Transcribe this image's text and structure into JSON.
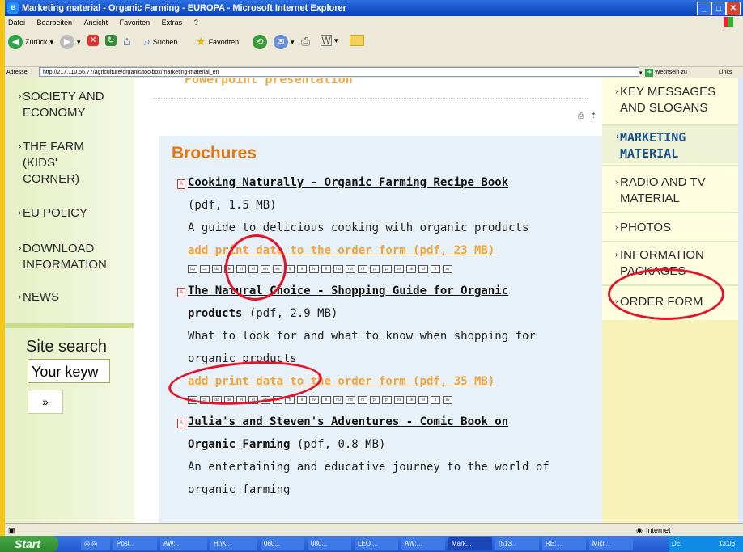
{
  "window": {
    "title": "Marketing material - Organic Farming - EUROPA - Microsoft Internet Explorer"
  },
  "menubar": [
    "Datei",
    "Bearbeiten",
    "Ansicht",
    "Favoriten",
    "Extras",
    "?"
  ],
  "toolbar": {
    "back": "Zurück",
    "search": "Suchen",
    "favorites": "Favoriten"
  },
  "addressbar": {
    "label": "Adresse",
    "url": "http://217.110.56.77/agriculture/organic/toolbox/marketing-material_en",
    "go": "Wechseln zu",
    "links": "Links"
  },
  "leftnav": {
    "items": [
      {
        "label": "SOCIETY AND ECONOMY"
      },
      {
        "label": "THE FARM (KIDS' CORNER)"
      },
      {
        "label": "EU POLICY"
      },
      {
        "label": "DOWNLOAD INFORMATION"
      },
      {
        "label": "NEWS"
      }
    ],
    "site_search": "Site search",
    "search_placeholder": "Your keyw",
    "search_button": "»"
  },
  "main": {
    "previous_link": "Powerpoint presentation",
    "heading": "Brochures",
    "brochures": [
      {
        "title": "Cooking Naturally - Organic Farming Recipe Book",
        "meta": "(pdf, 1.5 MB)",
        "description": "A guide to delicious cooking with organic products",
        "order_link": "add print data to the order form (pdf, 23 MB)"
      },
      {
        "title_line1": "The Natural Choice - Shopping Guide for Organic",
        "title_line2": "products",
        "meta": "(pdf, 2.9 MB)",
        "description_line1": "What to look for and what to know when shopping for",
        "description_line2": "organic products",
        "order_link": "add print data to the order form (pdf, 35 MB)"
      },
      {
        "title_line1": "Julia's and Steven's Adventures - Comic Book on",
        "title_line2": "Organic Farming",
        "meta": "(pdf, 0.8 MB)",
        "description_line1": "An entertaining and educative journey to the world of",
        "description_line2": "organic farming"
      }
    ],
    "languages": [
      "bg",
      "cs",
      "da",
      "de",
      "et",
      "el",
      "en",
      "es",
      "fr",
      "it",
      "lv",
      "lt",
      "hu",
      "mt",
      "nl",
      "pl",
      "pt",
      "ro",
      "sk",
      "sl",
      "fi",
      "sv"
    ]
  },
  "rightnav": {
    "items": [
      {
        "label": "KEY MESSAGES AND SLOGANS"
      },
      {
        "label": "MARKETING MATERIAL",
        "active": true
      },
      {
        "label": "RADIO AND TV MATERIAL"
      },
      {
        "label": "PHOTOS"
      },
      {
        "label": "INFORMATION PACKAGES"
      },
      {
        "label": "ORDER FORM"
      }
    ]
  },
  "statusbar": {
    "zone": "Internet"
  },
  "taskbar": {
    "start": "Start",
    "tasks": [
      "Post...",
      "AW:...",
      "H:\\K...",
      "080...",
      "080...",
      "LEO ...",
      "AW:...",
      "Mark...",
      "(513...",
      "RE: ...",
      "Micr..."
    ],
    "lang": "DE",
    "time": "13:06"
  },
  "colors": {
    "heading": "#e07812",
    "order_link": "#f0a53c",
    "annotation": "#e0142b",
    "left_panel": "#e6efc4",
    "right_panel": "#fffde0"
  }
}
